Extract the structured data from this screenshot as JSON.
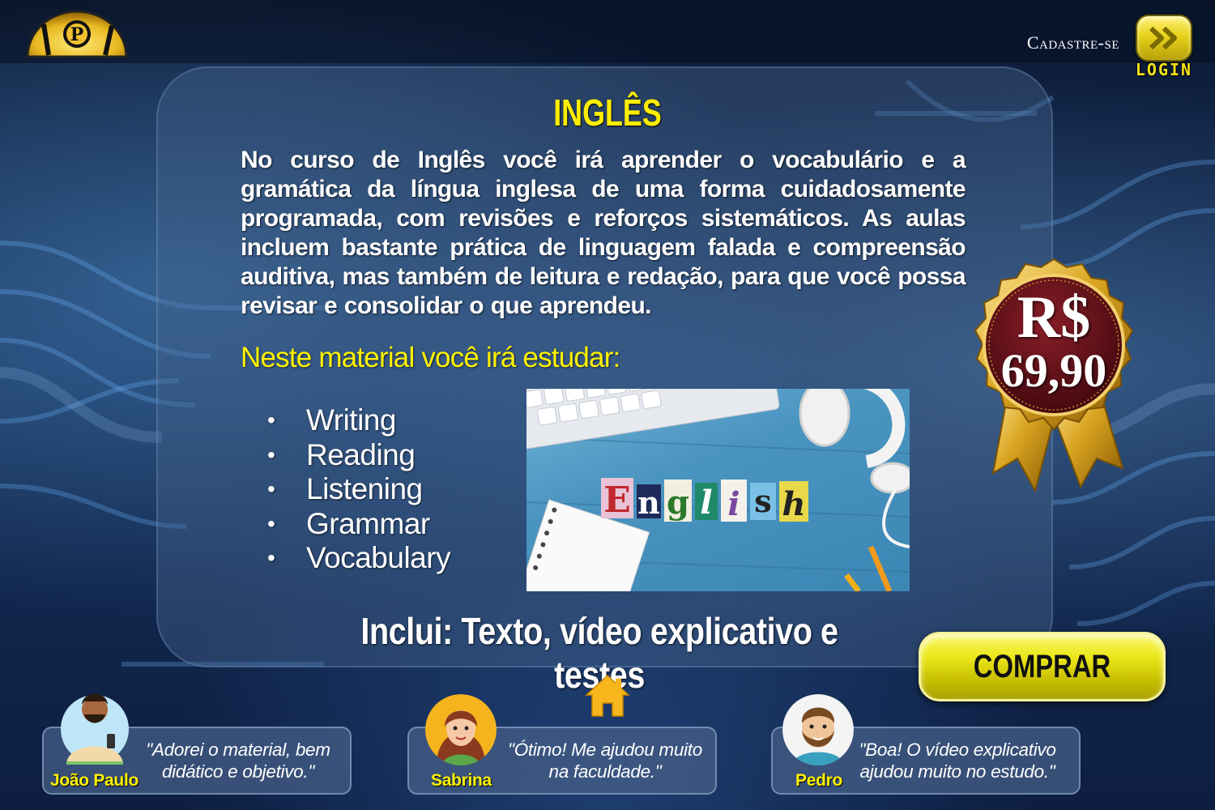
{
  "header": {
    "signup_label": "Cadastre-se",
    "login_label": "LOGIN"
  },
  "course": {
    "title": "INGLÊS",
    "description": "No curso de Inglês você irá aprender o vocabulário e a gramática da língua inglesa de uma forma cuidadosamente programada, com revisões e reforços sistemáticos. As aulas incluem bastante prática de linguagem falada e compreensão auditiva, mas também de leitura e redação, para que você possa revisar e consolidar o que aprendeu.",
    "study_heading": "Neste material você irá estudar:",
    "topics": [
      "Writing",
      "Reading",
      "Listening",
      "Grammar",
      "Vocabulary"
    ],
    "image_letters": [
      "E",
      "n",
      "g",
      "l",
      "i",
      "s",
      "h"
    ],
    "includes": "Inclui: Texto, vídeo explicativo e testes"
  },
  "price": {
    "currency": "R$",
    "value": "69,90"
  },
  "purchase": {
    "buy_label": "COMPRAR"
  },
  "testimonials": [
    {
      "name": "João Paulo",
      "quote": "\"Adorei o material, bem didático e objetivo.\""
    },
    {
      "name": "Sabrina",
      "quote": "\"Ótimo! Me ajudou muito na faculdade.\""
    },
    {
      "name": "Pedro",
      "quote": "\"Boa! O vídeo explicativo ajudou muito no estudo.\""
    }
  ],
  "colors": {
    "accent_yellow": "#fff200",
    "badge_maroon": "#5a0f16",
    "gold": "#d9a520"
  },
  "icons": {
    "logo": "logo-icon",
    "login": "double-chevron-right-icon",
    "home": "home-icon"
  }
}
